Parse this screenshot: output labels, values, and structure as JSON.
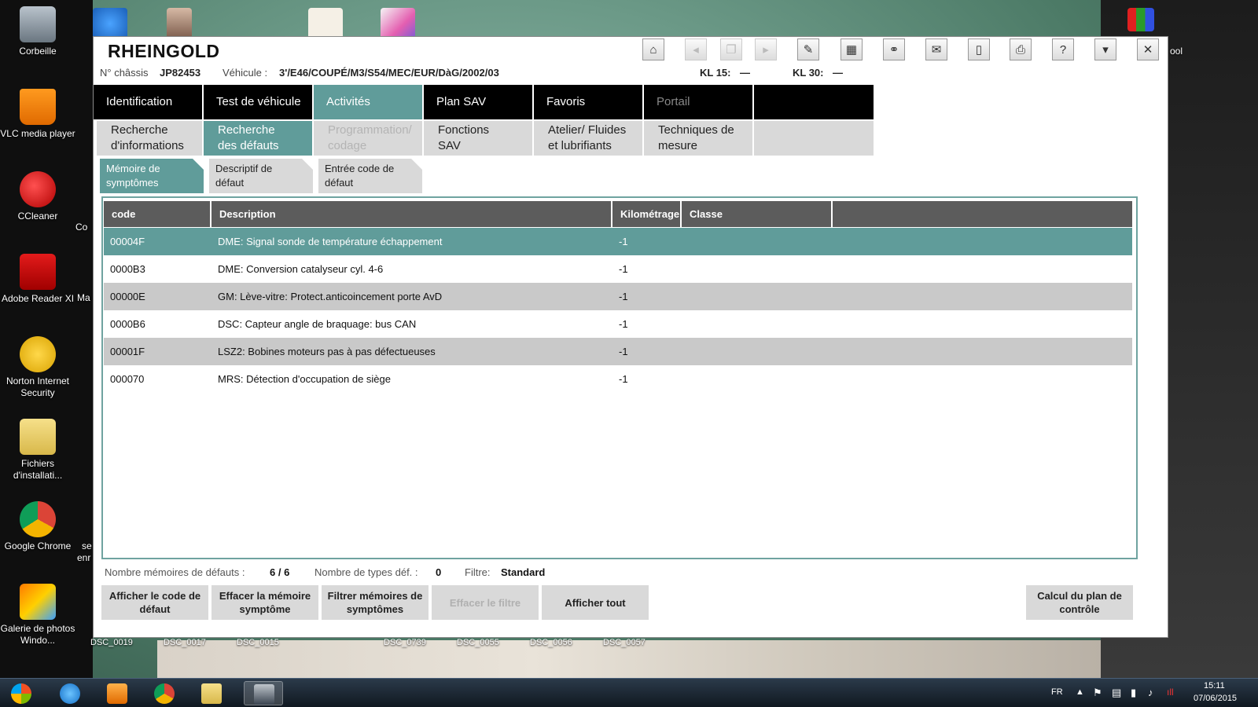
{
  "desktop": {
    "icons": [
      {
        "label": "Corbeille",
        "icon": "recycle-bin-icon"
      },
      {
        "label": "VLC media player",
        "icon": "vlc-icon"
      },
      {
        "label": "CCleaner",
        "icon": "ccleaner-icon"
      },
      {
        "label": "Adobe Reader XI",
        "icon": "adobe-reader-icon"
      },
      {
        "label": "Norton Internet Security",
        "icon": "norton-icon"
      },
      {
        "label": "Fichiers d'installati...",
        "icon": "folder-icon"
      },
      {
        "label": "Google Chrome",
        "icon": "chrome-icon"
      },
      {
        "label": "Galerie de photos Windo...",
        "icon": "photo-gallery-icon"
      }
    ],
    "partial_labels": [
      "Co",
      "Ma",
      "se",
      "enr",
      "ool"
    ],
    "thumbnail_labels": [
      "DSC_0019",
      "DSC_0017",
      "DSC_0015",
      "DSC_0739",
      "DSC_0055",
      "DSC_0056",
      "DSC_0057"
    ]
  },
  "app": {
    "title": "RHEINGOLD",
    "toolbar_icons": [
      "home-icon",
      "back-icon",
      "documents-icon",
      "forward-icon",
      "wrench-icon",
      "compare-icon",
      "link-icon",
      "mail-icon",
      "battery-icon",
      "print-icon",
      "help-icon",
      "minimize-icon",
      "close-icon"
    ],
    "vehicle": {
      "chassis_label": "N° châssis",
      "chassis_value": "JP82453",
      "vehicle_label": "Véhicule :",
      "vehicle_value": "3'/E46/COUPÉ/M3/S54/MEC/EUR/DàG/2002/03",
      "kl15_label": "KL 15:",
      "kl15_value": "—",
      "kl30_label": "KL 30:",
      "kl30_value": "—"
    },
    "nav_main": [
      {
        "label": "Identification",
        "state": "normal"
      },
      {
        "label": "Test de véhicule",
        "state": "normal"
      },
      {
        "label": "Activités",
        "state": "active"
      },
      {
        "label": "Plan SAV",
        "state": "normal"
      },
      {
        "label": "Favoris",
        "state": "normal"
      },
      {
        "label": "Portail",
        "state": "disabled"
      },
      {
        "label": "",
        "state": "normal"
      }
    ],
    "nav_sub": [
      {
        "line1": "Recherche",
        "line2": "d'informations",
        "state": "normal"
      },
      {
        "line1": "Recherche",
        "line2": "des défauts",
        "state": "active"
      },
      {
        "line1": "Programmation/",
        "line2": "codage",
        "state": "disabled"
      },
      {
        "line1": "Fonctions",
        "line2": "SAV",
        "state": "normal"
      },
      {
        "line1": "Atelier/ Fluides",
        "line2": "et lubrifiants",
        "state": "normal"
      },
      {
        "line1": "Techniques de",
        "line2": "mesure",
        "state": "normal"
      },
      {
        "line1": "",
        "line2": "",
        "state": "normal"
      }
    ],
    "tabs": [
      {
        "line1": "Mémoire de",
        "line2": "symptômes",
        "state": "active"
      },
      {
        "line1": "Descriptif de",
        "line2": "défaut",
        "state": "normal"
      },
      {
        "line1": "Entrée code de",
        "line2": "défaut",
        "state": "normal"
      }
    ],
    "table": {
      "columns": [
        "code",
        "Description",
        "Kilométrage",
        "Classe",
        ""
      ],
      "rows": [
        {
          "code": "00004F",
          "description": "DME: Signal sonde de température échappement",
          "km": "-1",
          "classe": ""
        },
        {
          "code": "0000B3",
          "description": "DME: Conversion catalyseur cyl. 4-6",
          "km": "-1",
          "classe": ""
        },
        {
          "code": "00000E",
          "description": "GM: Lève-vitre: Protect.anticoincement porte AvD",
          "km": "-1",
          "classe": ""
        },
        {
          "code": "0000B6",
          "description": "DSC: Capteur angle de braquage: bus CAN",
          "km": "-1",
          "classe": ""
        },
        {
          "code": "00001F",
          "description": "LSZ2: Bobines moteurs pas à pas défectueuses",
          "km": "-1",
          "classe": ""
        },
        {
          "code": "000070",
          "description": "MRS: Détection d'occupation de siège",
          "km": "-1",
          "classe": ""
        }
      ]
    },
    "status": {
      "memories_label": "Nombre mémoires de défauts :",
      "memories_value": "6 / 6",
      "types_label": "Nombre de types déf. :",
      "types_value": "0",
      "filter_label": "Filtre:",
      "filter_value": "Standard"
    },
    "buttons": {
      "show_code": "Afficher le code de défaut",
      "clear_memory": "Effacer la mémoire symptôme",
      "filter_memories": "Filtrer mémoires de symptômes",
      "clear_filter": "Effacer le filtre",
      "show_all": "Afficher tout",
      "calc_plan": "Calcul du plan de contrôle"
    }
  },
  "taskbar": {
    "language": "FR",
    "time": "15:11",
    "date": "07/06/2015"
  },
  "colors": {
    "accent": "#609c9a",
    "nav_dark": "#000000",
    "header_grey": "#5c5c5c",
    "row_grey": "#c9c9c9"
  }
}
